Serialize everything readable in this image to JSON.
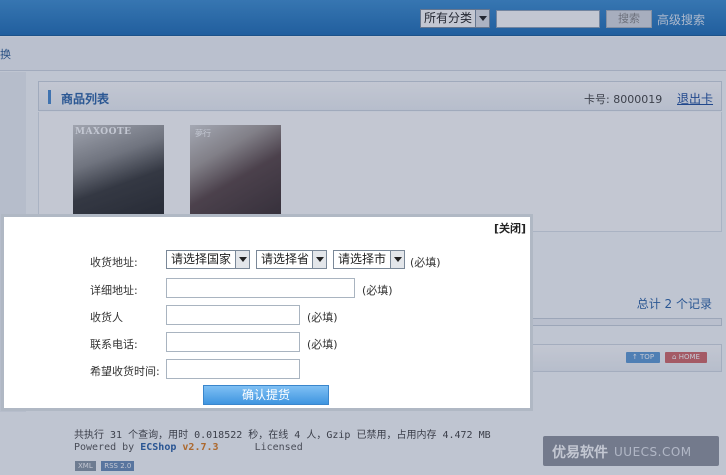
{
  "header": {
    "category_select": "所有分类",
    "search_value": "",
    "search_button": "搜索",
    "advanced_search": "高级搜索"
  },
  "subnav": {
    "link": "换"
  },
  "main": {
    "title": "商品列表",
    "card_label": "卡号: 8000019",
    "logout_card": "退出卡",
    "goods": [
      {
        "image_text": "MAXOOTE"
      },
      {
        "image_text": "夢行"
      }
    ],
    "total": "总计 2 个记录"
  },
  "badges": {
    "top": "↑ TOP",
    "home": "⌂ HOME"
  },
  "footer": {
    "stats": "共执行 31 个查询，用时 0.018522 秒，在线 4 人，Gzip 已禁用，占用内存 4.472 MB",
    "powered_prefix": "Powered by",
    "brand": "ECShop",
    "version": "v2.7.3",
    "licensed": "Licensed",
    "xml": "XML",
    "rss": "RSS 2.0"
  },
  "watermark": {
    "main": "优易软件",
    "url": "UUECS.COM"
  },
  "modal": {
    "close": "[关闭]",
    "address_label": "收货地址:",
    "country": "请选择国家",
    "province": "请选择省",
    "city": "请选择市",
    "required": "(必填)",
    "detail_label": "详细地址:",
    "receiver_label": "收货人",
    "phone_label": "联系电话:",
    "time_label": "希望收货时间:",
    "detail_value": "",
    "receiver_value": "",
    "phone_value": "",
    "time_value": "",
    "confirm": "确认提货"
  },
  "colors": {
    "topbar": "#1f6fb8",
    "link": "#2d65a8",
    "confirm": "#3f95e0"
  }
}
